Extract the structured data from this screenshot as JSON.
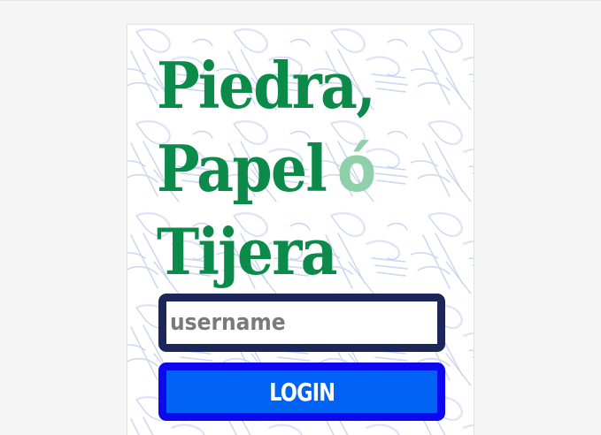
{
  "title": {
    "line1": "Piedra,",
    "line2": "Papel",
    "conjunction": "ó",
    "line3": "Tijera"
  },
  "form": {
    "username_placeholder": "username",
    "username_value": "",
    "login_label": "LOGIN"
  },
  "colors": {
    "title": "#0c8a4a",
    "conjunction": "#8fcfaa",
    "input_border": "#1d2659",
    "button_fill": "#0063f5",
    "button_border": "#0d08ee",
    "pattern_stroke": "#c9d6ef"
  },
  "background": {
    "pattern_icon": "hands-rock-paper-scissors-pattern"
  }
}
